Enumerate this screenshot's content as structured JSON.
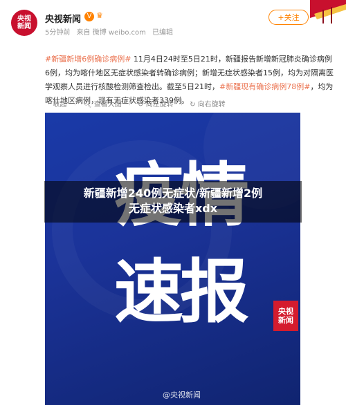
{
  "post": {
    "account_name": "央视新闻",
    "avatar_text_1": "央视",
    "avatar_text_2": "新闻",
    "time": "5分钟前",
    "source": "来自 微博 weibo.com",
    "edited": "已编辑",
    "follow_label": "+关注",
    "hashtag_1": "#新疆新增6例确诊病例#",
    "text_1": " 11月4日24时至5日21时，新疆报告新增新冠肺炎确诊病例6例，均为喀什地区无症状感染者转确诊病例；新增无症状感染者15例，均为对隔离医学观察人员进行核酸检测筛查检出。截至5日21时，",
    "hashtag_2": "#新疆现有确诊病例78例#",
    "text_2": "，均为喀什地区病例，现有无症状感染者339例。"
  },
  "actions": {
    "collapse": "收起",
    "view_large": "查看大图",
    "rotate_left": "向左旋转",
    "rotate_right": "向右旋转"
  },
  "image": {
    "headline_1": "疫情",
    "headline_2": "速报",
    "logo_1": "央视",
    "logo_2": "新闻",
    "watermark": "@央视新闻"
  },
  "overlay": {
    "line_1": "新疆新增240例无症状/新疆新增2例",
    "line_2": "无症状感染者xdx"
  },
  "colors": {
    "accent": "#ff8200",
    "tag": "#eb7350",
    "image_bg": "#1b3399"
  }
}
